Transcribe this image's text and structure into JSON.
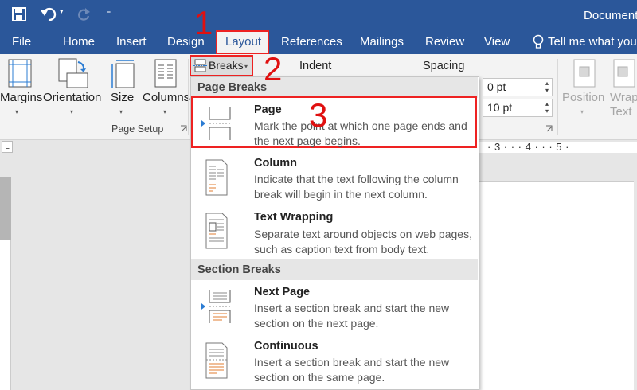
{
  "titlebar": {
    "doc_title": "Document",
    "undo_dropdown": "▾",
    "customize": "₌"
  },
  "tabs": [
    "File",
    "Home",
    "Insert",
    "Design",
    "Layout",
    "References",
    "Mailings",
    "Review",
    "View"
  ],
  "tell_me": "Tell me what you",
  "ribbon": {
    "margins": "Margins",
    "orientation": "Orientation",
    "size": "Size",
    "columns": "Columns",
    "group_label": "Page Setup",
    "breaks": "Breaks",
    "indent": "Indent",
    "spacing": "Spacing",
    "spacing_before": "0 pt",
    "spacing_after": "10 pt",
    "position": "Position",
    "wrap_line1": "Wrap",
    "wrap_line2": "Text"
  },
  "annotations": {
    "step1": "1",
    "step2": "2",
    "step3": "3"
  },
  "ruler": {
    "corner": "L",
    "marks": "·  3  ·  ·  ·  4  ·  ·  ·  5  ·"
  },
  "menu": {
    "page_breaks_header": "Page Breaks",
    "section_breaks_header": "Section Breaks",
    "items": [
      {
        "title": "Page",
        "desc": "Mark the point at which one page ends and the next page begins."
      },
      {
        "title": "Column",
        "desc": "Indicate that the text following the column break will begin in the next column."
      },
      {
        "title": "Text Wrapping",
        "desc": "Separate text around objects on web pages, such as caption text from body text."
      },
      {
        "title": "Next Page",
        "desc": "Insert a section break and start the new section on the next page."
      },
      {
        "title": "Continuous",
        "desc": "Insert a section break and start the new section on the same page."
      }
    ]
  },
  "colors": {
    "word_blue": "#2b579a",
    "highlight_red": "#e22222",
    "accent_orange": "#e07d32"
  }
}
